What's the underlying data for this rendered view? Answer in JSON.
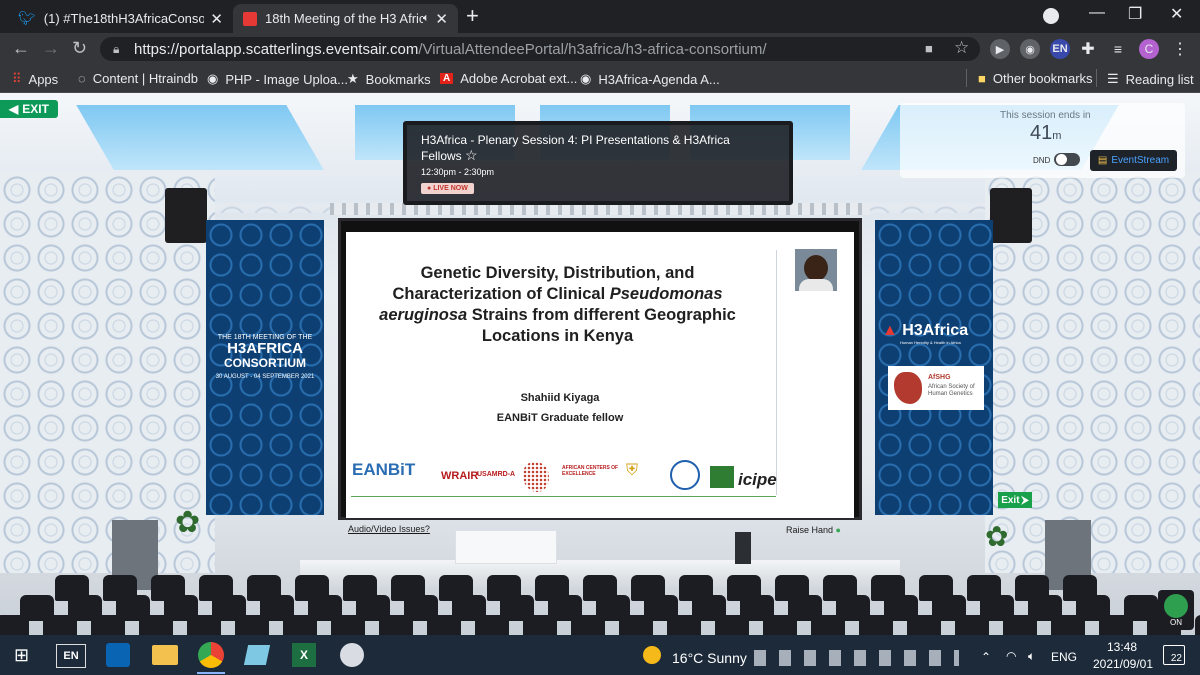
{
  "browser": {
    "tabs": [
      {
        "title": "(1) #The18thH3AfricaConsortium",
        "icon": "twitter-icon",
        "active": false
      },
      {
        "title": "18th Meeting of the H3 Afric",
        "icon": "eventsair-icon",
        "active": true
      }
    ],
    "url_host": "https://portalapp.scatterlings.eventsair.com",
    "url_path": "/VirtualAttendeePortal/h3africa/h3-africa-consortium/",
    "profile_initial": "C",
    "lang_badge": "EN",
    "bookmarks": [
      {
        "label": "Apps",
        "icon": "apps-grid-icon"
      },
      {
        "label": "Content | Htraindb",
        "icon": "globe-icon"
      },
      {
        "label": "PHP - Image Uploa...",
        "icon": "globe-icon"
      },
      {
        "label": "Bookmarks",
        "icon": "star-icon"
      },
      {
        "label": "Adobe Acrobat ext...",
        "icon": "acrobat-icon"
      },
      {
        "label": "H3Africa-Agenda A...",
        "icon": "globe-icon"
      }
    ],
    "other_bookmarks": "Other bookmarks",
    "reading_list": "Reading list"
  },
  "venue": {
    "exit_label": "EXIT",
    "session": {
      "title_line1": "H3Africa - Plenary Session 4: PI Presentations & H3Africa",
      "title_line2": "Fellows",
      "time": "12:30pm - 2:30pm",
      "live": "LIVE NOW"
    },
    "timer": {
      "label": "This session ends in",
      "value": "41",
      "unit": "m"
    },
    "dnd_label": "DND",
    "eventstream_label": "EventStream",
    "left_banner": {
      "line1": "THE 18TH MEETING OF THE",
      "line2": "H3AFRICA",
      "line3": "CONSORTIUM",
      "dates": "30 AUGUST - 04 SEPTEMBER 2021"
    },
    "right_banner": {
      "brand": "H3Africa",
      "tagline": "Human Heredity & Health in Africa",
      "afshg": "AfSHG",
      "afshg_name": "African Society of Human Genetics"
    },
    "exit_sign": "Exit",
    "av_issues": "Audio/Video Issues?",
    "raise_hand": "Raise Hand",
    "on_badge": "ON",
    "slide": {
      "title_l1": "Genetic Diversity, Distribution, and",
      "title_l2a": "Characterization of Clinical ",
      "title_l2b": "Pseudomonas",
      "title_l3a": "aeruginosa",
      "title_l3b": " Strains from different Geographic",
      "title_l4": "Locations in Kenya",
      "presenter": "Shahiid Kiyaga",
      "role": "EANBiT Graduate fellow",
      "logos": [
        "EANBiT",
        "WRAIR",
        "USAMRD-A",
        "AFRICAN CENTERS OF EXCELLENCE",
        "icipe"
      ]
    }
  },
  "taskbar": {
    "lang": "EN",
    "weather": "16°C  Sunny",
    "input_lang": "ENG",
    "time": "13:48",
    "date": "2021/09/01",
    "notifications": "22"
  }
}
